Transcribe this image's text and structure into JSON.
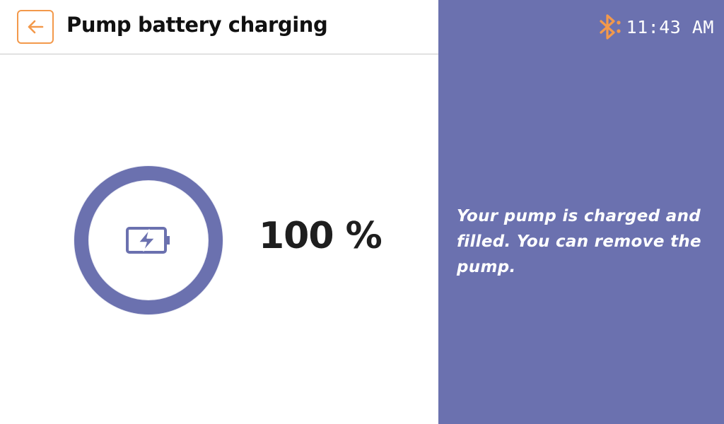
{
  "header": {
    "title": "Pump battery charging",
    "back_icon": "arrow-left-icon"
  },
  "charge": {
    "percent_label": "100 %",
    "level": 1.0,
    "icon": "battery-charging-icon"
  },
  "status_bar": {
    "bluetooth_icon": "bluetooth-icon",
    "time": "11:43 AM"
  },
  "message": {
    "text": "Your pump is charged and filled. You can remove the pump."
  },
  "colors": {
    "accent": "#f3994b",
    "panel": "#6b71af",
    "ring": "#6b71af",
    "ring_track": "#ecedf5"
  }
}
